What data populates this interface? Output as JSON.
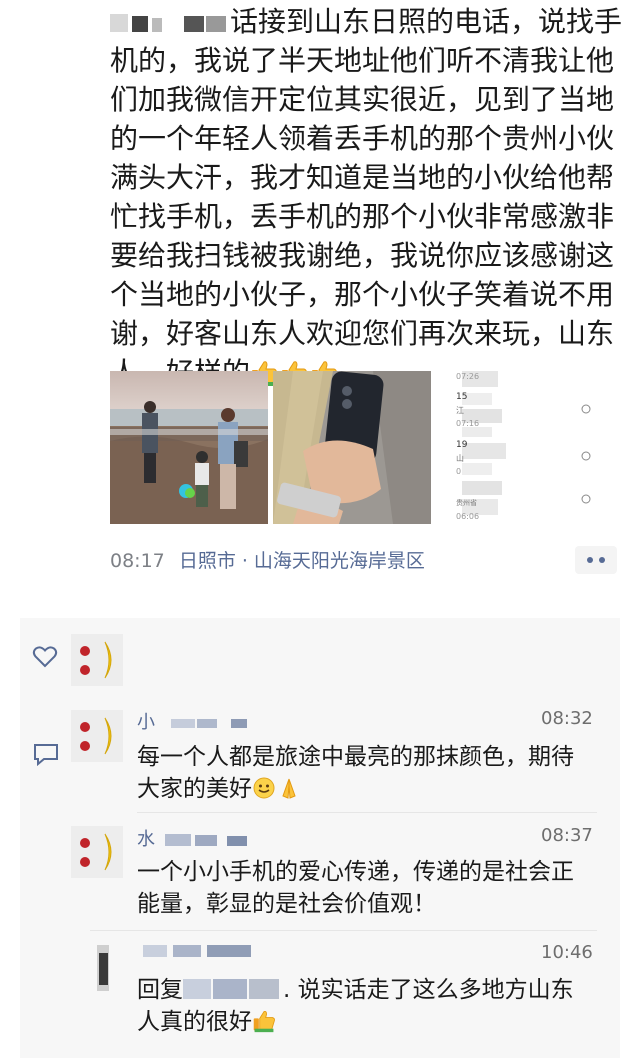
{
  "post": {
    "lines": [
      "话接到山东日照的电话，说找手",
      "机的，我说了半天地址他们听不清我让他",
      "们加我微信开定位其实很近，见到了当地",
      "的一个年轻人领着丢手机的那个贵州小伙",
      "满头大汗，我才知道是当地的小伙给他帮",
      "忙找手机，丢手机的那个小伙非常感激非",
      "要给我扫钱被我谢绝，我说你应该感谢这",
      "个当地的小伙子，那个小伙子笑着说不用",
      "谢，好客山东人欢迎您们再次来玩，山东",
      "人，好样的"
    ],
    "time": "08:17",
    "location": "日照市 · 山海天阳光海岸景区",
    "screenshot_text": {
      "t1": "07:26",
      "t2": "15",
      "t3": "江",
      "t4": "07:16",
      "t5": "19",
      "t6": "山",
      "t7": "0",
      "t8": "贵州省",
      "t9": "06:06"
    }
  },
  "comments": [
    {
      "name": "小",
      "time": "08:32",
      "lines": [
        "每一个人都是旅途中最亮的那抹颜色，期待",
        "大家的美好"
      ]
    },
    {
      "name": "水",
      "time": "08:37",
      "lines": [
        "一个小小手机的爱心传递，传递的是社会正",
        "能量，彰显的是社会价值观！"
      ]
    },
    {
      "name": "",
      "time": "10:46",
      "reply_prefix": "回复",
      "lines": [
        ". 说实话走了这么多地方山东",
        "人真的很好"
      ]
    }
  ],
  "colors": {
    "link": "#576b95",
    "meta": "#7d8086",
    "comment_bg": "#f7f7f7"
  },
  "icons": [
    "thumbs-up-icon",
    "heart-icon",
    "comment-icon",
    "more-icon",
    "smile-icon",
    "pray-hands-icon"
  ]
}
